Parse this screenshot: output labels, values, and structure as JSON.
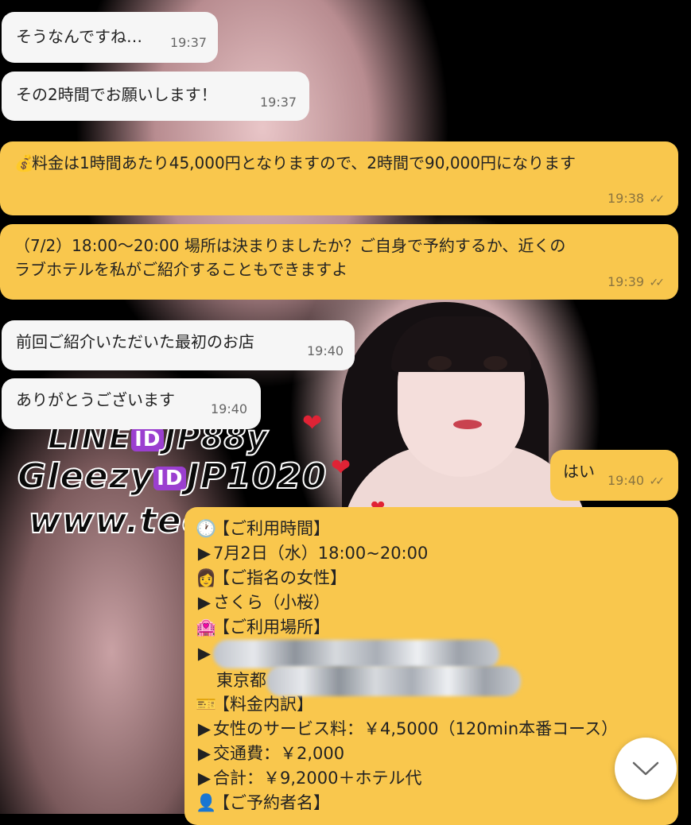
{
  "messages": {
    "m1": {
      "text": "そうなんですね…",
      "time": "19:37"
    },
    "m2": {
      "text": "その2時間でお願いします！",
      "time": "19:37"
    },
    "m3": {
      "icon": "money-bag-icon",
      "text": "料金は1時間あたり45,000円となりますので、2時間で90,000円になります",
      "time": "19:38"
    },
    "m4": {
      "line1": "（7/2）18:00～20:00 場所は決まりましたか？ご自身で予約するか、近くの",
      "line2": "ラブホテルを私がご紹介することもできますよ",
      "time": "19:39"
    },
    "m5": {
      "text": "前回ご紹介いただいた最初のお店",
      "time": "19:40"
    },
    "m6": {
      "text": "ありがとうございます",
      "time": "19:40"
    },
    "m7": {
      "text": "はい",
      "time": "19:40"
    },
    "m8": {
      "rows": [
        {
          "icon": "clock-icon",
          "glyph": "🕐",
          "text": "【ご利用時間】"
        },
        {
          "icon": "arrow-icon",
          "glyph": "▶",
          "text": "7月2日（水）18:00~20:00"
        },
        {
          "icon": "woman-icon",
          "glyph": "👩",
          "text": "【ご指名の女性】"
        },
        {
          "icon": "arrow-icon",
          "glyph": "▶",
          "text": "さくら（小桜）"
        },
        {
          "icon": "hotel-icon",
          "glyph": "🏩",
          "text": "【ご利用場所】"
        },
        {
          "icon": "arrow-icon",
          "glyph": "▶",
          "text": ""
        },
        {
          "icon": "",
          "glyph": "",
          "text": "東京都"
        },
        {
          "icon": "ticket-icon",
          "glyph": "🎫",
          "text": "【料金内訳】"
        },
        {
          "icon": "arrow-icon",
          "glyph": "▶",
          "text": "女性のサービス料：￥4,5000（120min本番コース）"
        },
        {
          "icon": "arrow-icon",
          "glyph": "▶",
          "text": "交通費：￥2,000"
        },
        {
          "icon": "arrow-icon",
          "glyph": "▶",
          "text": "合計：￥9,2000＋ホテル代"
        },
        {
          "icon": "person-icon",
          "glyph": "👤",
          "text": "【ご予約者名】"
        }
      ]
    }
  },
  "watermark": {
    "line1_pre": "LINE",
    "line1_id": "ID",
    "line1_post": "JP88y",
    "line2_pre": "Gleezy",
    "line2_id": "ID",
    "line2_post": "JP1020",
    "line3": "www.tec"
  },
  "read_mark": "✓✓",
  "colors": {
    "outgoing": "#f9c74d",
    "incoming": "#f6f6f6"
  }
}
